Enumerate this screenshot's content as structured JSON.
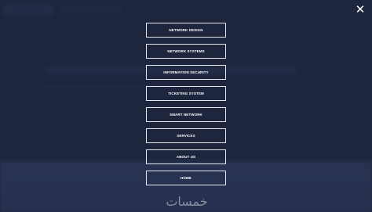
{
  "nav_overlay": {
    "close_glyph": "✕",
    "items": [
      {
        "label": "NETWORK DESIGN"
      },
      {
        "label": "NETWORK SYSTEMS"
      },
      {
        "label": "INFORMATION SECURITY"
      },
      {
        "label": "TICKETING SYSTEM"
      },
      {
        "label": "SMART NETWORK"
      },
      {
        "label": "SERVICES"
      },
      {
        "label": "ABOUT US"
      },
      {
        "label": "HOME"
      }
    ]
  },
  "watermark": {
    "text": "خمسات"
  },
  "colors": {
    "background": "#232b44",
    "footer": "#3b4770",
    "menu_border": "#e6e8ef",
    "text": "#ffffff"
  }
}
